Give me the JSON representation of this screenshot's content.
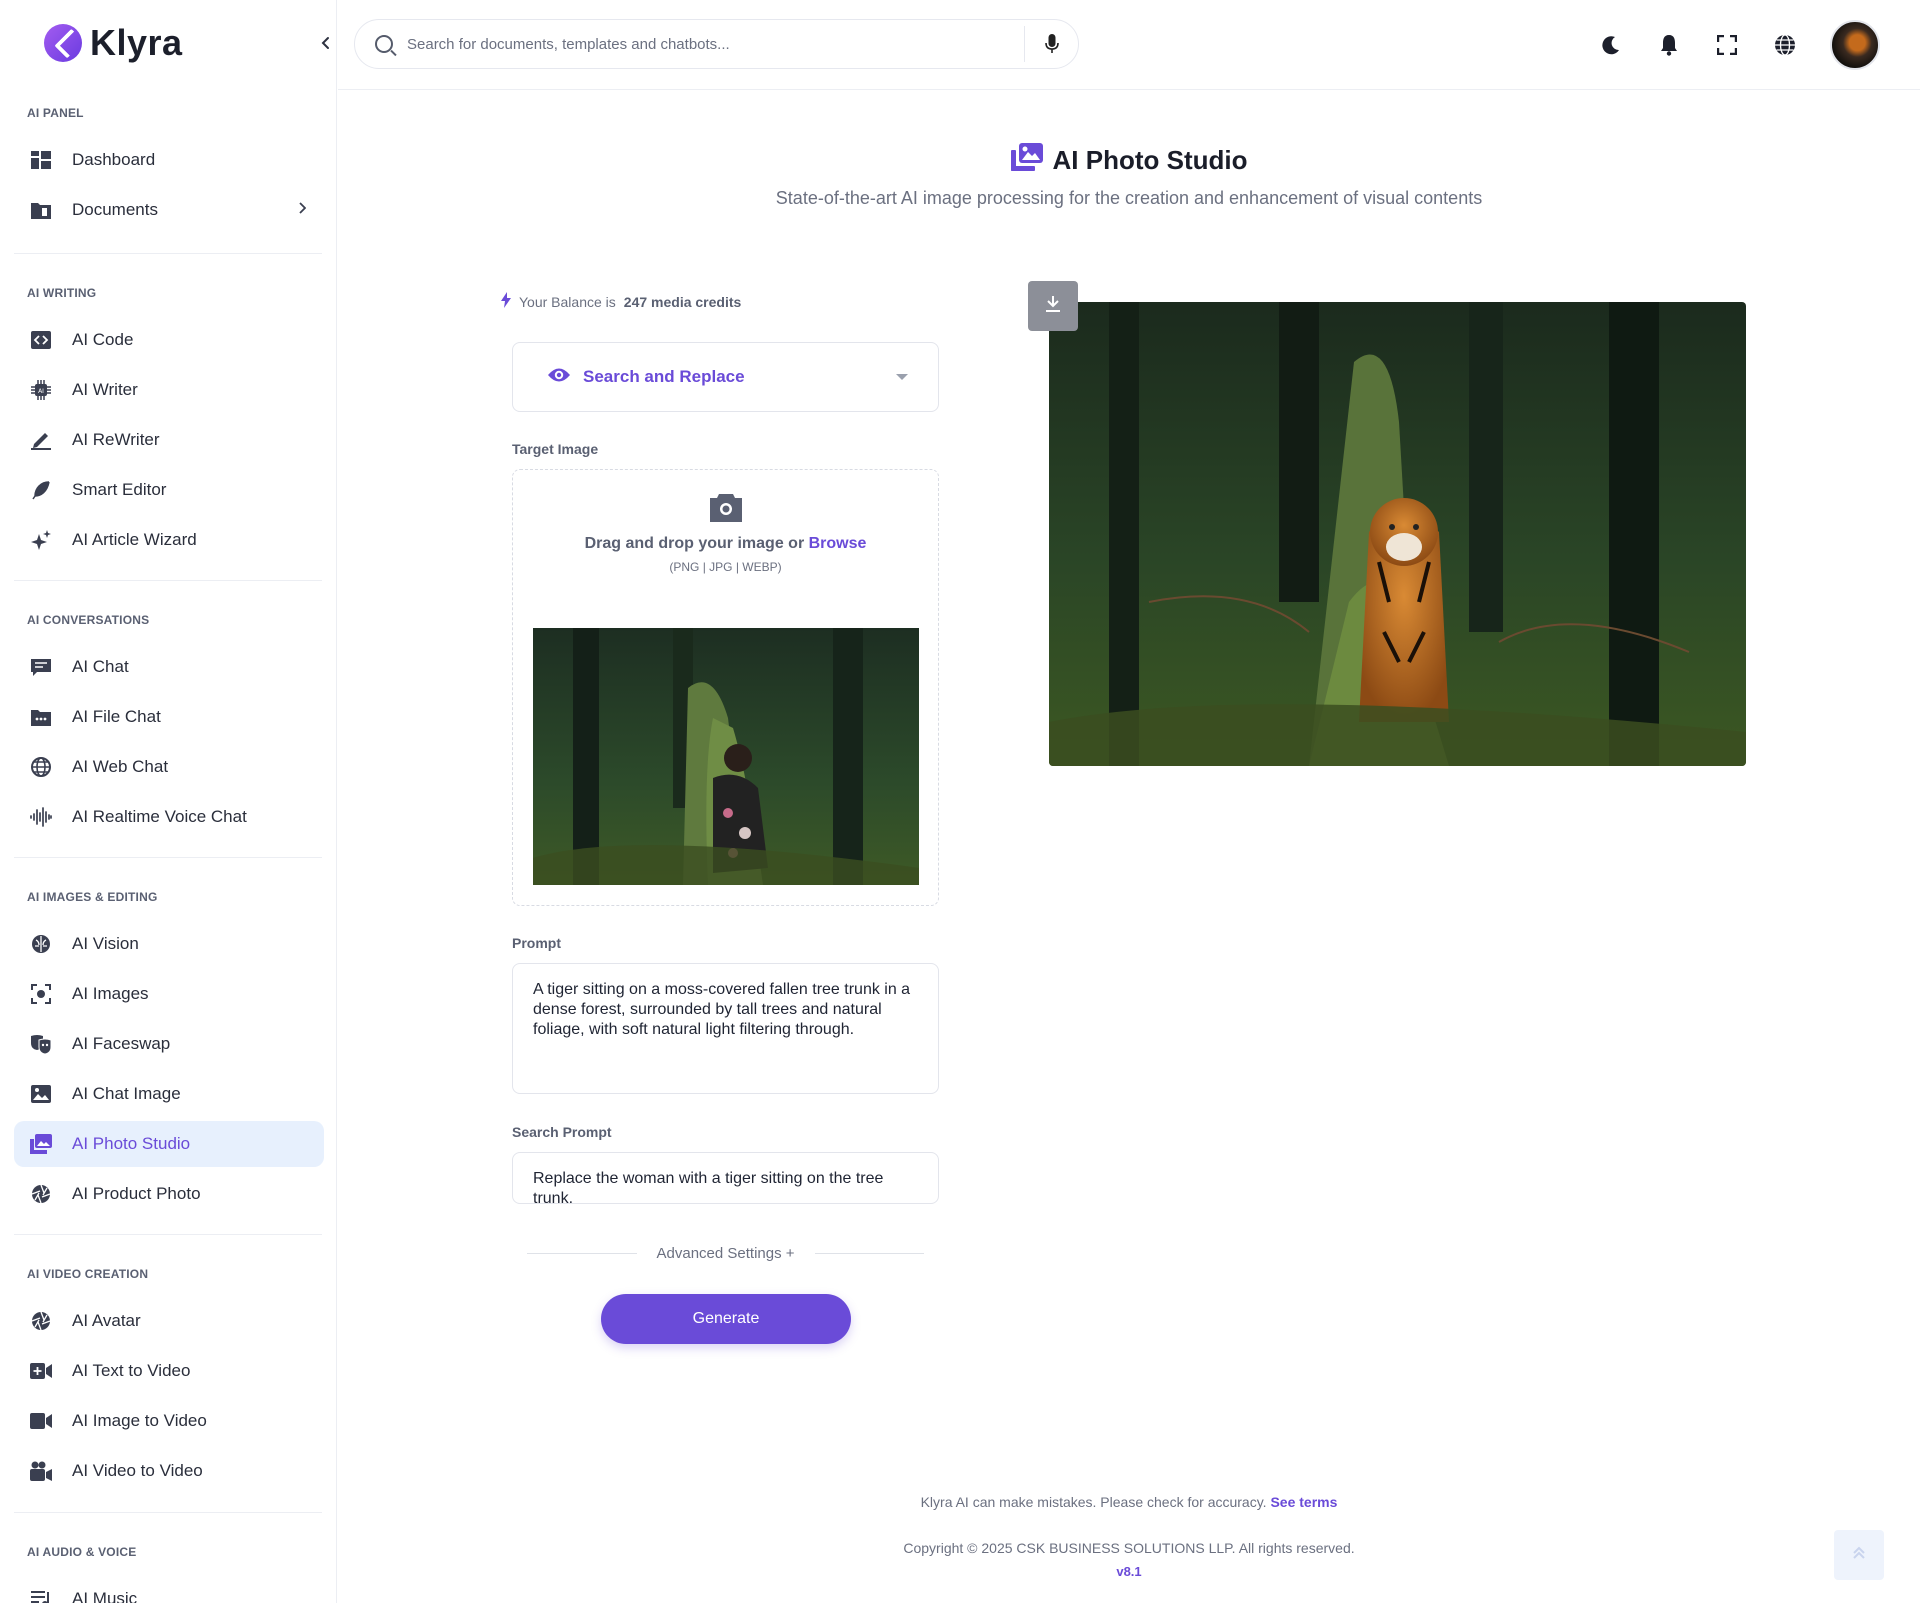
{
  "app": {
    "name": "Klyra"
  },
  "search": {
    "placeholder": "Search for documents, templates and chatbots..."
  },
  "sidebar": {
    "sections": [
      {
        "label": "AI PANEL",
        "items": [
          "Dashboard",
          "Documents"
        ]
      },
      {
        "label": "AI WRITING",
        "items": [
          "AI Code",
          "AI Writer",
          "AI ReWriter",
          "Smart Editor",
          "AI Article Wizard"
        ]
      },
      {
        "label": "AI CONVERSATIONS",
        "items": [
          "AI Chat",
          "AI File Chat",
          "AI Web Chat",
          "AI Realtime Voice Chat"
        ]
      },
      {
        "label": "AI IMAGES & EDITING",
        "items": [
          "AI Vision",
          "AI Images",
          "AI Faceswap",
          "AI Chat Image",
          "AI Photo Studio",
          "AI Product Photo"
        ]
      },
      {
        "label": "AI VIDEO CREATION",
        "items": [
          "AI Avatar",
          "AI Text to Video",
          "AI Image to Video",
          "AI Video to Video"
        ]
      },
      {
        "label": "AI AUDIO & VOICE",
        "items": [
          "AI Music"
        ]
      }
    ],
    "active_item": "AI Photo Studio"
  },
  "page": {
    "title": "AI Photo Studio",
    "subtitle": "State-of-the-art AI image processing for the creation and enhancement of visual contents"
  },
  "balance": {
    "prefix": "Your Balance is",
    "value": "247 media credits"
  },
  "tool_select": {
    "selected": "Search and Replace"
  },
  "target_image": {
    "label": "Target Image",
    "drop_text": "Drag and drop your image or",
    "browse": "Browse",
    "formats": "(PNG | JPG | WEBP)"
  },
  "prompt": {
    "label": "Prompt",
    "value": "A tiger sitting on a moss-covered fallen tree trunk in a dense forest, surrounded by tall trees and natural foliage, with soft natural light filtering through."
  },
  "search_prompt": {
    "label": "Search Prompt",
    "value": "Replace the woman with a tiger sitting on the tree trunk."
  },
  "advanced_settings": "Advanced Settings +",
  "generate_label": "Generate",
  "footer": {
    "disclaimer": "Klyra AI can make mistakes. Please check for accuracy.",
    "terms": "See terms",
    "copyright": "Copyright © 2025 CSK BUSINESS SOLUTIONS LLP. All rights reserved.",
    "version": "v8.1"
  },
  "colors": {
    "accent": "#6a4bd8",
    "active_bg": "#e7f0fd"
  },
  "icons": {
    "sidebar": [
      "dashboard-icon",
      "folder-icon",
      "code-icon",
      "chip-icon",
      "pen-icon",
      "feather-icon",
      "sparkles-icon",
      "chat-icon",
      "file-chat-icon",
      "globe-icon",
      "waveform-icon",
      "brain-icon",
      "scan-icon",
      "masks-icon",
      "image-icon",
      "photos-icon",
      "aperture-icon",
      "aperture-icon",
      "video-plus-icon",
      "video-icon",
      "video-users-icon",
      "music-icon"
    ]
  }
}
